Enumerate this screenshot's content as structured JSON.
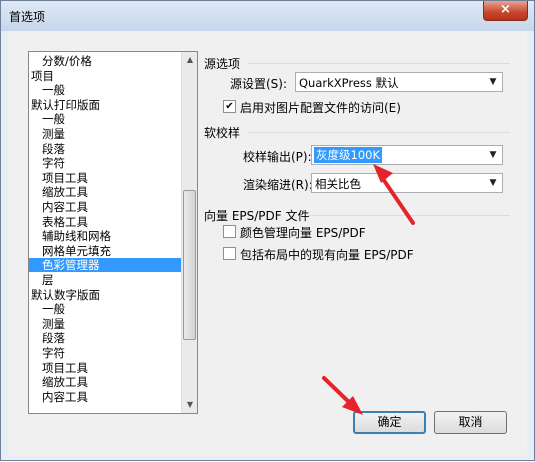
{
  "window": {
    "title": "首选项",
    "close_label": "×"
  },
  "list": {
    "items": [
      {
        "label": "分数/价格",
        "indent": 1
      },
      {
        "label": "项目",
        "indent": 0
      },
      {
        "label": "一般",
        "indent": 1
      },
      {
        "label": "默认打印版面",
        "indent": 0
      },
      {
        "label": "一般",
        "indent": 1
      },
      {
        "label": "测量",
        "indent": 1
      },
      {
        "label": "段落",
        "indent": 1
      },
      {
        "label": "字符",
        "indent": 1
      },
      {
        "label": "项目工具",
        "indent": 1
      },
      {
        "label": "缩放工具",
        "indent": 1
      },
      {
        "label": "内容工具",
        "indent": 1
      },
      {
        "label": "表格工具",
        "indent": 1
      },
      {
        "label": "辅助线和网格",
        "indent": 1
      },
      {
        "label": "网格单元填充",
        "indent": 1
      },
      {
        "label": "色彩管理器",
        "indent": 1,
        "selected": true
      },
      {
        "label": "层",
        "indent": 1
      },
      {
        "label": "默认数字版面",
        "indent": 0
      },
      {
        "label": "一般",
        "indent": 1
      },
      {
        "label": "测量",
        "indent": 1
      },
      {
        "label": "段落",
        "indent": 1
      },
      {
        "label": "字符",
        "indent": 1
      },
      {
        "label": "项目工具",
        "indent": 1
      },
      {
        "label": "缩放工具",
        "indent": 1
      },
      {
        "label": "内容工具",
        "indent": 1
      }
    ]
  },
  "source": {
    "section_title": "源选项",
    "setting_label": "源设置(S):",
    "setting_value": "QuarkXPress 默认",
    "enable_profile_label": "启用对图片配置文件的访问(E)"
  },
  "proof": {
    "section_title": "软校样",
    "output_label": "校样输出(P):",
    "output_value": "灰度级100K",
    "intent_label": "渲染缩进(R):",
    "intent_value": "相关比色"
  },
  "eps": {
    "section_title": "向量 EPS/PDF 文件",
    "color_manage_label": "颜色管理向量 EPS/PDF",
    "include_layout_label": "包括布局中的现有向量 EPS/PDF"
  },
  "buttons": {
    "ok_label": "确定",
    "cancel_label": "取消"
  },
  "colors": {
    "accent": "#3399ff",
    "arrow": "#e5232b"
  }
}
